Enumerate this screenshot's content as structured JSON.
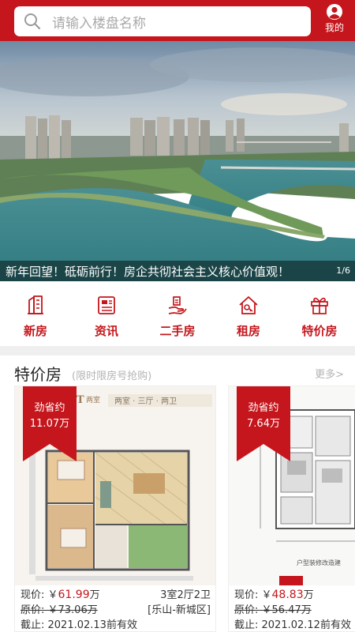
{
  "header": {
    "search_placeholder": "请输入楼盘名称",
    "me_label": "我的",
    "accent": "#c4161c"
  },
  "banner": {
    "caption": "新年回望！砥砺前行！房企共彻社会主义核心价值观！",
    "counter": "1/6"
  },
  "nav": {
    "items": [
      {
        "label": "新房",
        "icon": "building-icon"
      },
      {
        "label": "资讯",
        "icon": "news-icon"
      },
      {
        "label": "二手房",
        "icon": "hand-house-icon"
      },
      {
        "label": "租房",
        "icon": "house-key-icon"
      },
      {
        "label": "特价房",
        "icon": "gift-icon"
      }
    ]
  },
  "special": {
    "title": "特价房",
    "subtitle": "(限时限房号抢购)",
    "more": "更多>",
    "cards": [
      {
        "ribbon_line1": "劲省约",
        "ribbon_line2": "11.07万",
        "plan_tag": "两室 · 三厅 · 两卫",
        "price_label": "现价: ￥",
        "price_value": "61.99",
        "price_unit": "万",
        "layout": "3室2厅2卫",
        "original_price": "原价: ￥73.06万",
        "location": "[乐山-新城区]",
        "deadline": "截止: 2021.02.13前有效"
      },
      {
        "ribbon_line1": "劲省约",
        "ribbon_line2": "7.64万",
        "plan_tag": "户型装修改造建",
        "price_label": "现价: ￥",
        "price_value": "48.83",
        "price_unit": "万",
        "original_price": "原价: ￥56.47万",
        "deadline": "截止: 2021.02.12前有效"
      }
    ]
  }
}
